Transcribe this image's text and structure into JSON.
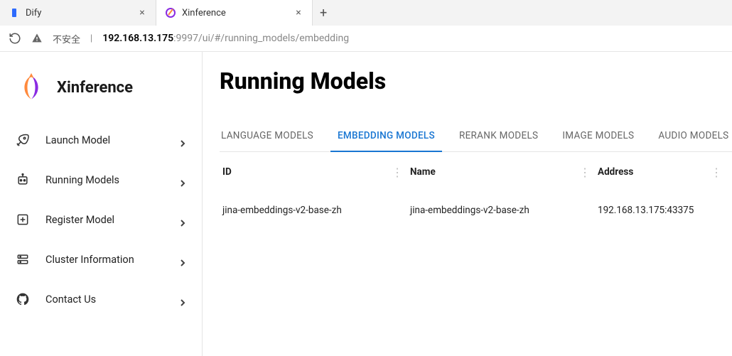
{
  "browser": {
    "tabs": [
      {
        "title": "Dify",
        "active": false
      },
      {
        "title": "Xinference",
        "active": true
      }
    ],
    "security_text": "不安全",
    "url_host": "192.168.13.175",
    "url_port": ":9997",
    "url_path": "/ui/#/running_models/embedding"
  },
  "sidebar": {
    "brand": "Xinference",
    "items": [
      {
        "label": "Launch Model"
      },
      {
        "label": "Running Models"
      },
      {
        "label": "Register Model"
      },
      {
        "label": "Cluster Information"
      },
      {
        "label": "Contact Us"
      }
    ]
  },
  "main": {
    "title": "Running Models",
    "tabs": [
      {
        "label": "LANGUAGE MODELS",
        "active": false
      },
      {
        "label": "EMBEDDING MODELS",
        "active": true
      },
      {
        "label": "RERANK MODELS",
        "active": false
      },
      {
        "label": "IMAGE MODELS",
        "active": false
      },
      {
        "label": "AUDIO MODELS",
        "active": false
      }
    ],
    "columns": {
      "id": "ID",
      "name": "Name",
      "address": "Address"
    },
    "rows": [
      {
        "id": "jina-embeddings-v2-base-zh",
        "name": "jina-embeddings-v2-base-zh",
        "address": "192.168.13.175:43375"
      }
    ]
  }
}
